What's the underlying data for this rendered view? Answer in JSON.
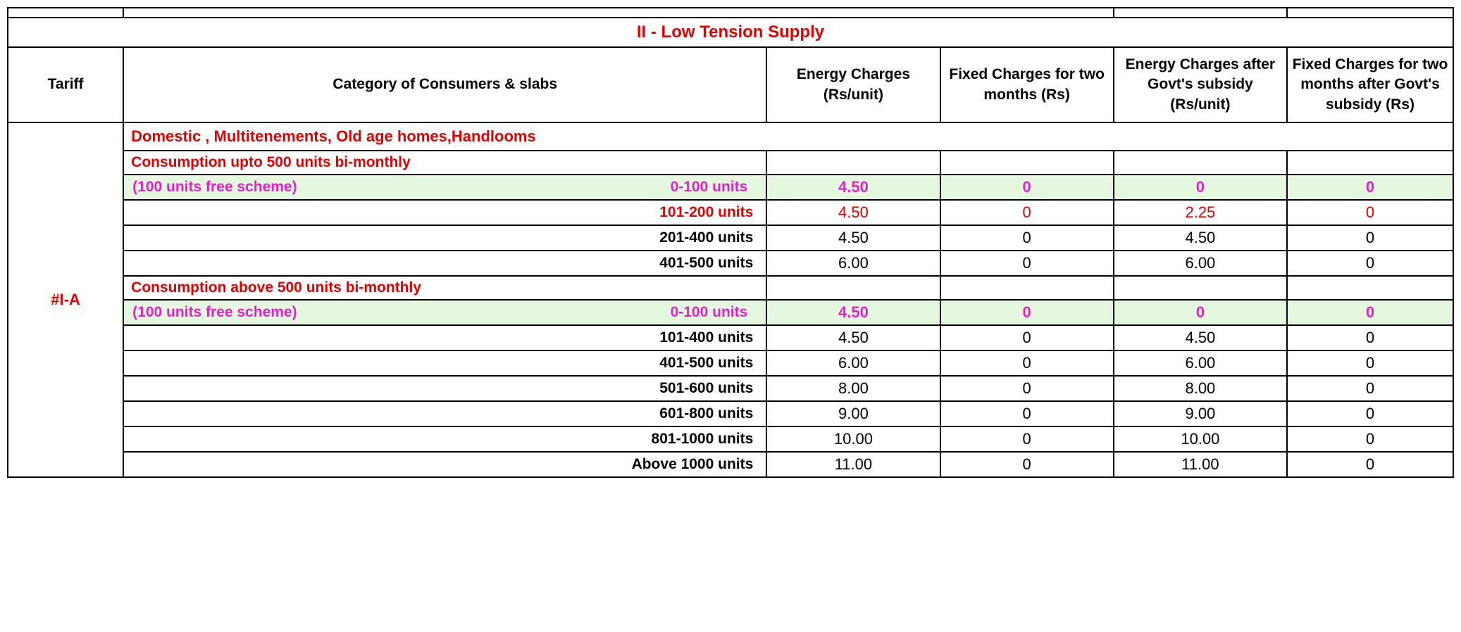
{
  "section_title": "II - Low Tension Supply",
  "headers": {
    "tariff": "Tariff",
    "category": "Category of Consumers & slabs",
    "energy_charges": "Energy  Charges (Rs/unit)",
    "fixed_charges": "Fixed Charges for two months (Rs)",
    "energy_after_subsidy": "Energy  Charges after   Govt's subsidy (Rs/unit)",
    "fixed_after_subsidy": "Fixed Charges for two months after Govt's subsidy (Rs)"
  },
  "tariff_code": "#I-A",
  "category_header": "Domestic , Multitenements, Old age homes,Handlooms",
  "group1": {
    "title": "Consumption upto 500 units bi-monthly",
    "free_scheme_label": "(100 units free scheme)",
    "free_scheme_range": "0-100 units",
    "rows": [
      {
        "slab": "0-100 units",
        "ec": "4.50",
        "fc": "0",
        "ecs": "0",
        "fcs": "0"
      },
      {
        "slab": "101-200 units",
        "ec": "4.50",
        "fc": "0",
        "ecs": "2.25",
        "fcs": "0"
      },
      {
        "slab": "201-400 units",
        "ec": "4.50",
        "fc": "0",
        "ecs": "4.50",
        "fcs": "0"
      },
      {
        "slab": "401-500 units",
        "ec": "6.00",
        "fc": "0",
        "ecs": "6.00",
        "fcs": "0"
      }
    ]
  },
  "group2": {
    "title": "Consumption above  500 units bi-monthly",
    "free_scheme_label": "(100 units free scheme)",
    "free_scheme_range": "0-100 units",
    "rows": [
      {
        "slab": "0-100 units",
        "ec": "4.50",
        "fc": "0",
        "ecs": "0",
        "fcs": "0"
      },
      {
        "slab": "101-400 units",
        "ec": "4.50",
        "fc": "0",
        "ecs": "4.50",
        "fcs": "0"
      },
      {
        "slab": "401-500 units",
        "ec": "6.00",
        "fc": "0",
        "ecs": "6.00",
        "fcs": "0"
      },
      {
        "slab": "501-600 units",
        "ec": "8.00",
        "fc": "0",
        "ecs": "8.00",
        "fcs": "0"
      },
      {
        "slab": "601-800 units",
        "ec": "9.00",
        "fc": "0",
        "ecs": "9.00",
        "fcs": "0"
      },
      {
        "slab": "801-1000 units",
        "ec": "10.00",
        "fc": "0",
        "ecs": "10.00",
        "fcs": "0"
      },
      {
        "slab": "Above 1000 units",
        "ec": "11.00",
        "fc": "0",
        "ecs": "11.00",
        "fcs": "0"
      }
    ]
  },
  "chart_data": {
    "type": "table",
    "title": "II - Low Tension Supply",
    "tariff": "#I-A",
    "category": "Domestic , Multitenements, Old age homes,Handlooms",
    "columns": [
      "Slab",
      "Energy Charges (Rs/unit)",
      "Fixed Charges for two months (Rs)",
      "Energy Charges after Govt's subsidy (Rs/unit)",
      "Fixed Charges for two months after Govt's subsidy (Rs)"
    ],
    "groups": [
      {
        "name": "Consumption upto 500 units bi-monthly",
        "rows": [
          [
            "0-100 units (100 units free scheme)",
            4.5,
            0,
            0,
            0
          ],
          [
            "101-200 units",
            4.5,
            0,
            2.25,
            0
          ],
          [
            "201-400 units",
            4.5,
            0,
            4.5,
            0
          ],
          [
            "401-500 units",
            6.0,
            0,
            6.0,
            0
          ]
        ]
      },
      {
        "name": "Consumption above 500 units bi-monthly",
        "rows": [
          [
            "0-100 units (100 units free scheme)",
            4.5,
            0,
            0,
            0
          ],
          [
            "101-400 units",
            4.5,
            0,
            4.5,
            0
          ],
          [
            "401-500 units",
            6.0,
            0,
            6.0,
            0
          ],
          [
            "501-600 units",
            8.0,
            0,
            8.0,
            0
          ],
          [
            "601-800 units",
            9.0,
            0,
            9.0,
            0
          ],
          [
            "801-1000 units",
            10.0,
            0,
            10.0,
            0
          ],
          [
            "Above 1000 units",
            11.0,
            0,
            11.0,
            0
          ]
        ]
      }
    ]
  }
}
